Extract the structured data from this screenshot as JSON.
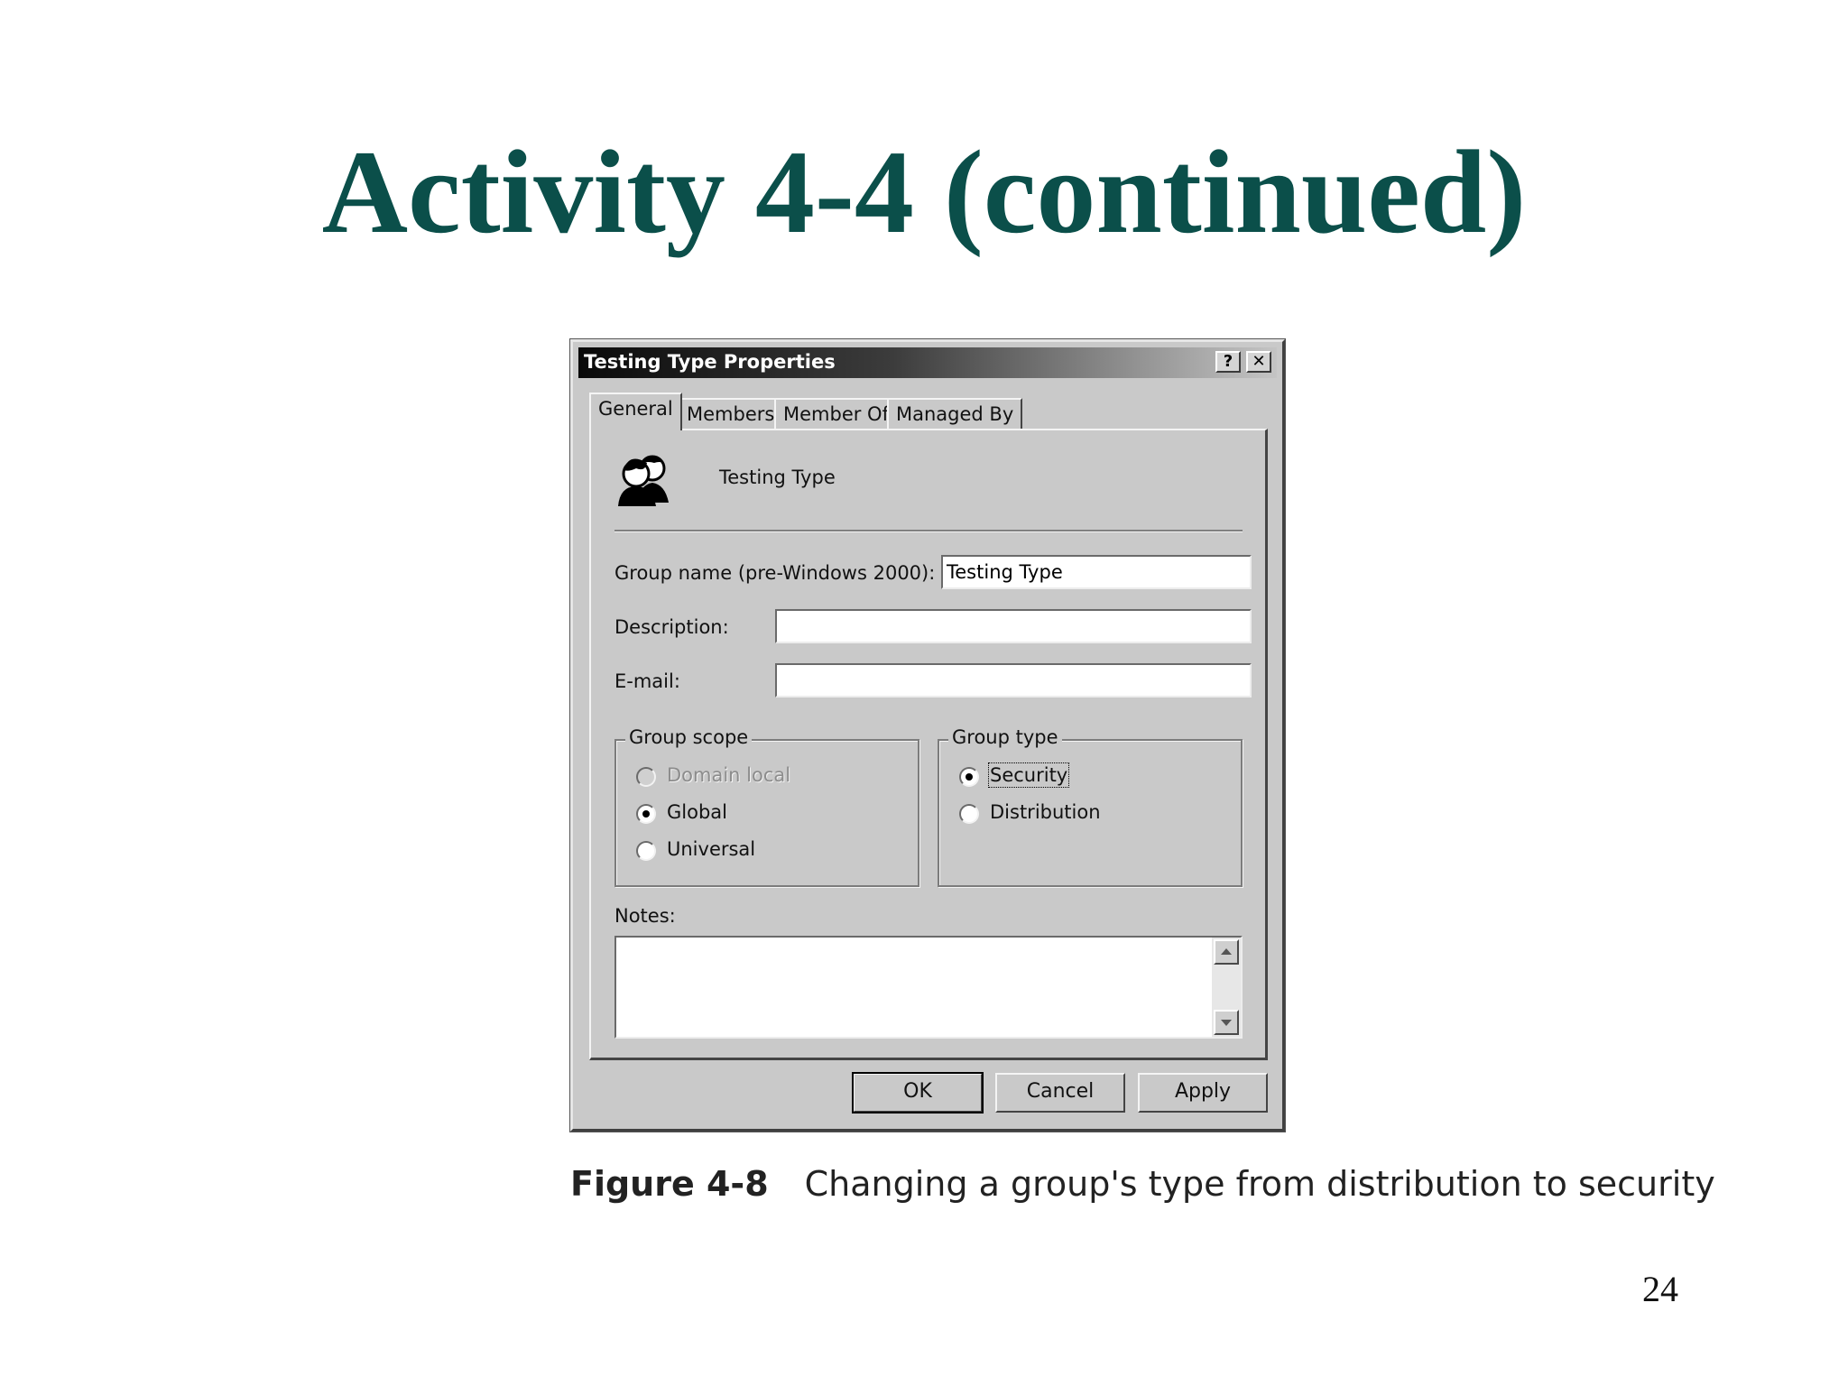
{
  "slide": {
    "title": "Activity 4-4 (continued)",
    "page_number": "24",
    "caption_label": "Figure 4-8",
    "caption_text": "Changing a group's type from distribution to security"
  },
  "dialog": {
    "title": "Testing Type Properties",
    "help_button": "?",
    "close_button": "✕",
    "tabs": [
      "General",
      "Members",
      "Member Of",
      "Managed By"
    ],
    "group_display_name": "Testing Type",
    "fields": {
      "group_name_label": "Group name (pre-Windows 2000):",
      "group_name_value": "Testing Type",
      "description_label": "Description:",
      "description_value": "",
      "email_label": "E-mail:",
      "email_value": ""
    },
    "group_scope": {
      "legend": "Group scope",
      "options": [
        {
          "label": "Domain local",
          "selected": false,
          "enabled": false
        },
        {
          "label": "Global",
          "selected": true,
          "enabled": true
        },
        {
          "label": "Universal",
          "selected": false,
          "enabled": true
        }
      ]
    },
    "group_type": {
      "legend": "Group type",
      "options": [
        {
          "label": "Security",
          "selected": true,
          "enabled": true
        },
        {
          "label": "Distribution",
          "selected": false,
          "enabled": true
        }
      ]
    },
    "notes_label": "Notes:",
    "notes_value": "",
    "buttons": {
      "ok": "OK",
      "cancel": "Cancel",
      "apply": "Apply"
    },
    "icons": {
      "group": "group-users-icon",
      "scroll_up": "arrow-up-icon",
      "scroll_down": "arrow-down-icon"
    }
  }
}
